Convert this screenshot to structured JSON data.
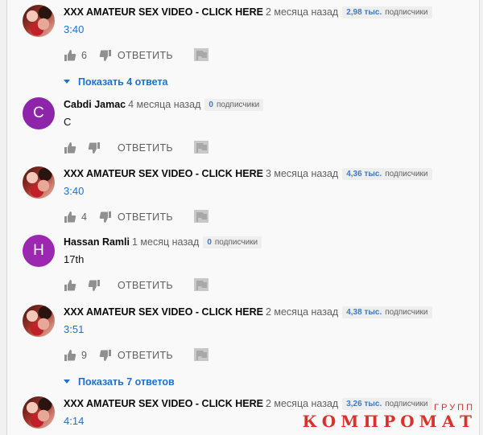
{
  "labels": {
    "reply": "ОТВЕТИТЬ",
    "subscribers": "подписчики"
  },
  "comments": [
    {
      "author": "XXX AMATEUR SEX VIDEO - CLICK HERE",
      "ago": "2 месяца назад",
      "subs": "2,98 тыс.",
      "text": "3:40",
      "likes": "6",
      "show_replies": "Показать 4 ответа"
    },
    {
      "author": "Cabdi Jamac",
      "avatar_letter": "C",
      "avatar_color": "#8e24aa",
      "ago": "4 месяца назад",
      "subs": "0",
      "text": "C"
    },
    {
      "author": "XXX AMATEUR SEX VIDEO - CLICK HERE",
      "ago": "3 месяца назад",
      "subs": "4,36 тыс.",
      "text": "3:40",
      "likes": "4"
    },
    {
      "author": "Hassan Ramli",
      "avatar_letter": "H",
      "avatar_color": "#9c27b0",
      "ago": "1 месяц назад",
      "subs": "0",
      "text": "17th"
    },
    {
      "author": "XXX AMATEUR SEX VIDEO - CLICK HERE",
      "ago": "2 месяца назад",
      "subs": "4,38 тыс.",
      "text": "3:51",
      "likes": "9",
      "show_replies": "Показать 7 ответов"
    },
    {
      "author": "XXX AMATEUR SEX VIDEO - CLICK HERE",
      "ago": "2 месяца назад",
      "subs": "3,26 тыс.",
      "text": "4:14"
    }
  ],
  "watermark": {
    "small": "ГРУПП",
    "big": "КОМПРОМАТ"
  },
  "colors": {
    "link": "#1f6fd1",
    "subs_count": "#3f79c6",
    "watermark": "#d8322b"
  }
}
